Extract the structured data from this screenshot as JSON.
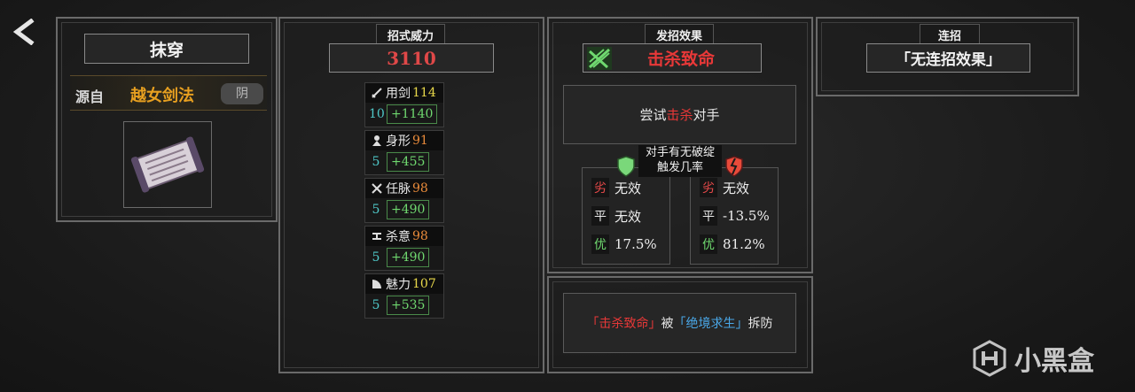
{
  "nav": {
    "back_icon": "chevron-left-icon"
  },
  "skill": {
    "name": "抹穿",
    "source_label": "源自",
    "source_name": "越女剑法",
    "source_tag": "阴",
    "scroll_icon": "scroll-icon"
  },
  "power": {
    "label": "招式威力",
    "value": "3110",
    "stats": [
      {
        "icon": "sword-icon",
        "name": "用剑",
        "value": "114",
        "value_color": "#e8d84a",
        "level": "10",
        "bonus": "+1140"
      },
      {
        "icon": "body-icon",
        "name": "身形",
        "value": "91",
        "value_color": "#e88a3a",
        "level": "5",
        "bonus": "+455"
      },
      {
        "icon": "meridian-icon",
        "name": "任脉",
        "value": "98",
        "value_color": "#e88a3a",
        "level": "5",
        "bonus": "+490"
      },
      {
        "icon": "killing-intent-icon",
        "name": "杀意",
        "value": "98",
        "value_color": "#e88a3a",
        "level": "5",
        "bonus": "+490"
      },
      {
        "icon": "fan-icon",
        "name": "魅力",
        "value": "107",
        "value_color": "#e8d84a",
        "level": "5",
        "bonus": "+535"
      }
    ]
  },
  "effect": {
    "label": "发招效果",
    "name": "击杀致命",
    "effect_icon": "slash-effect-icon",
    "desc_pre": "尝试",
    "desc_highlight": "击杀",
    "desc_post": "对手",
    "trigger_label_line1": "对手有无破绽",
    "trigger_label_line2": "触发几率",
    "left_icon": "shield-icon",
    "right_icon": "broken-shield-icon",
    "left_rates": [
      {
        "key": "劣",
        "key_color": "#e84a4a",
        "value": "无效"
      },
      {
        "key": "平",
        "key_color": "#e8e8e8",
        "value": "无效"
      },
      {
        "key": "优",
        "key_color": "#6fd86f",
        "value": "17.5%"
      }
    ],
    "right_rates": [
      {
        "key": "劣",
        "key_color": "#e84a4a",
        "value": "无效"
      },
      {
        "key": "平",
        "key_color": "#e8e8e8",
        "value": "-13.5%"
      },
      {
        "key": "优",
        "key_color": "#6fd86f",
        "value": "81.2%"
      }
    ],
    "counter_pre": "「击杀致命」",
    "counter_mid": "被",
    "counter_highlight": "「绝境求生」",
    "counter_post": "拆防"
  },
  "combo": {
    "label": "连招",
    "value": "「无连招效果」"
  },
  "watermark": {
    "text": "小黑盒",
    "icon": "heybox-logo-icon"
  },
  "colors": {
    "power_value": "#e04848",
    "effect_name": "#e83838",
    "source_name": "#e8a020",
    "kill_red": "#e83838",
    "counter_blue": "#4aa8e8"
  }
}
